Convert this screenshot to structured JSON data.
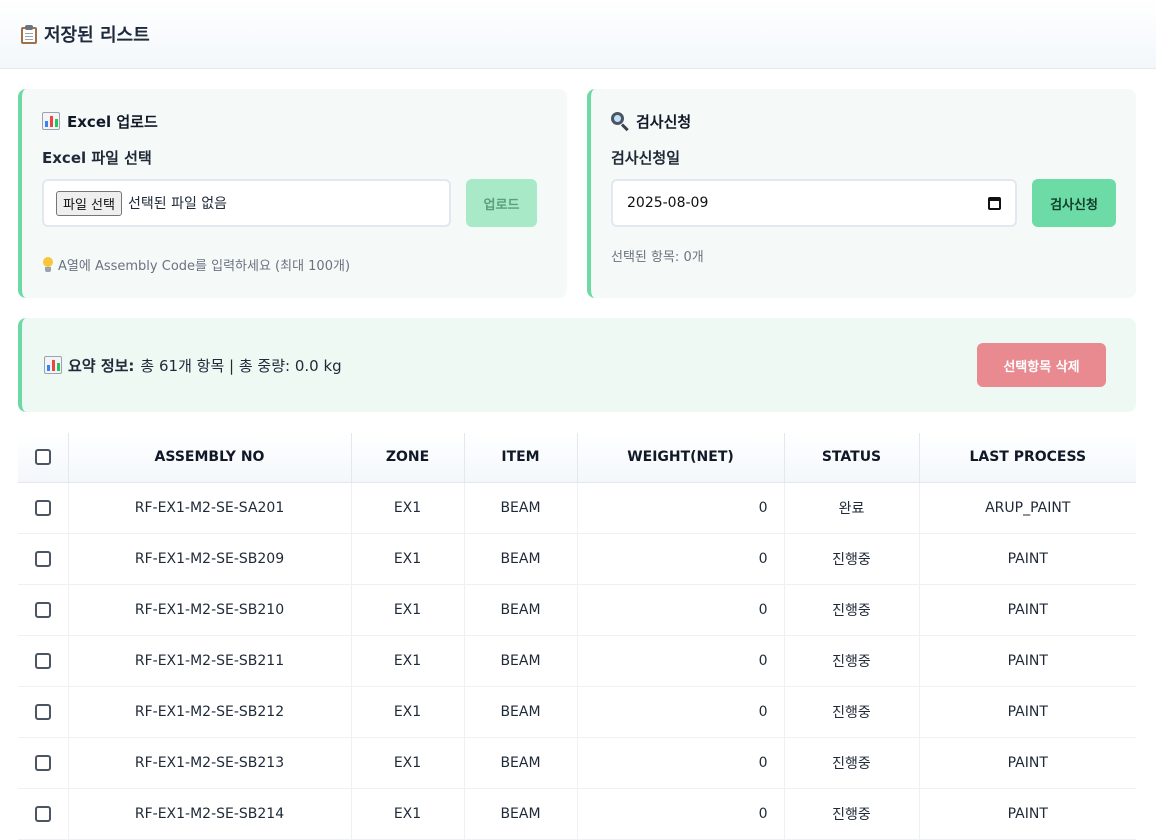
{
  "header": {
    "title": "저장된 리스트",
    "icon": "clipboard-icon"
  },
  "upload_panel": {
    "title": "Excel 업로드",
    "icon": "bar-chart-icon",
    "label": "Excel 파일 선택",
    "file_button": "파일 선택",
    "file_status": "선택된 파일 없음",
    "upload_button": "업로드",
    "hint": "A열에 Assembly Code를 입력하세요 (최대 100개)",
    "hint_icon": "lightbulb-icon"
  },
  "inspection_panel": {
    "title": "검사신청",
    "icon": "magnifier-icon",
    "label": "검사신청일",
    "date_value": "2025-08-09",
    "apply_button": "검사신청",
    "selected_text": "선택된 항목: 0개"
  },
  "summary": {
    "label": "요약 정보:",
    "text": "총 61개 항목 | 총 중량: 0.0 kg",
    "delete_button": "선택항목 삭제"
  },
  "table": {
    "columns": [
      "ASSEMBLY NO",
      "ZONE",
      "ITEM",
      "WEIGHT(NET)",
      "STATUS",
      "LAST PROCESS"
    ],
    "rows": [
      [
        "RF-EX1-M2-SE-SA201",
        "EX1",
        "BEAM",
        "0",
        "완료",
        "ARUP_PAINT"
      ],
      [
        "RF-EX1-M2-SE-SB209",
        "EX1",
        "BEAM",
        "0",
        "진행중",
        "PAINT"
      ],
      [
        "RF-EX1-M2-SE-SB210",
        "EX1",
        "BEAM",
        "0",
        "진행중",
        "PAINT"
      ],
      [
        "RF-EX1-M2-SE-SB211",
        "EX1",
        "BEAM",
        "0",
        "진행중",
        "PAINT"
      ],
      [
        "RF-EX1-M2-SE-SB212",
        "EX1",
        "BEAM",
        "0",
        "진행중",
        "PAINT"
      ],
      [
        "RF-EX1-M2-SE-SB213",
        "EX1",
        "BEAM",
        "0",
        "진행중",
        "PAINT"
      ],
      [
        "RF-EX1-M2-SE-SB214",
        "EX1",
        "BEAM",
        "0",
        "진행중",
        "PAINT"
      ]
    ]
  },
  "colors": {
    "accent": "#6dd9a4",
    "danger": "#e88a8f",
    "panel_bg": "#f5faf8"
  }
}
